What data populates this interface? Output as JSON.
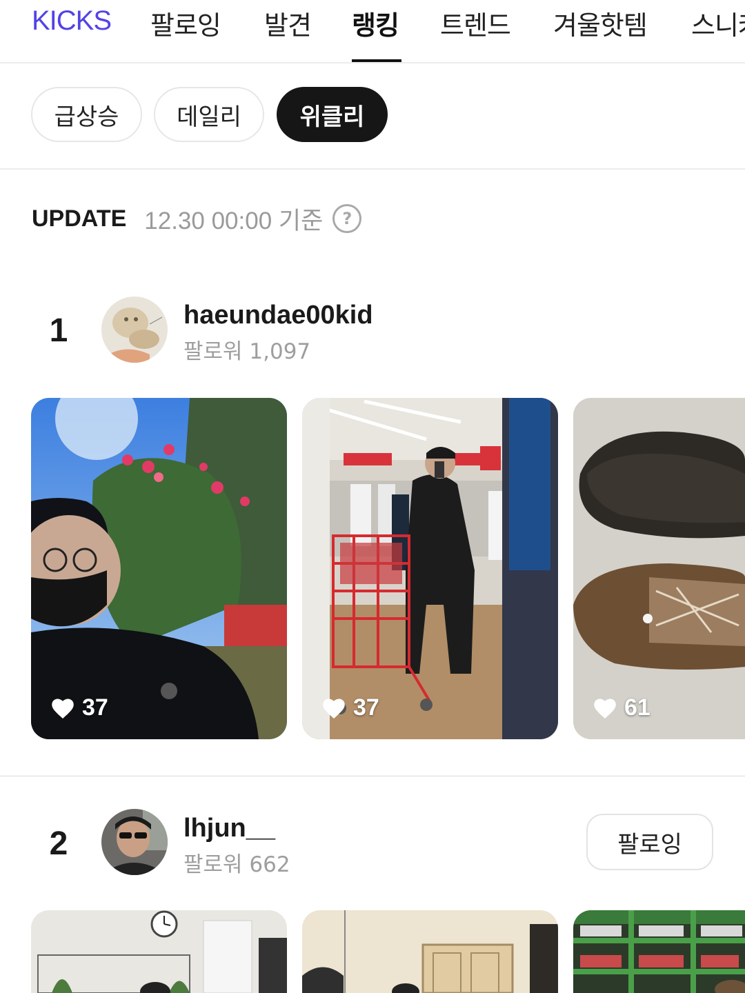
{
  "nav": {
    "tabs": [
      {
        "label": "KICKS"
      },
      {
        "label": "팔로잉"
      },
      {
        "label": "발견"
      },
      {
        "label": "랭킹"
      },
      {
        "label": "트렌드"
      },
      {
        "label": "겨울핫템"
      },
      {
        "label": "스니커"
      }
    ],
    "active_tab": "랭킹"
  },
  "filters": {
    "chips": [
      {
        "label": "급상승"
      },
      {
        "label": "데일리"
      },
      {
        "label": "위클리"
      }
    ],
    "active_chip": "위클리"
  },
  "update": {
    "label": "UPDATE",
    "time": "12.30 00:00 기준",
    "help_symbol": "?"
  },
  "rankings": [
    {
      "rank": "1",
      "username": "haeundae00kid",
      "followers": "팔로워 1,097",
      "posts": [
        {
          "likes": "37",
          "icon": "heart-icon"
        },
        {
          "likes": "37",
          "icon": "heart-icon"
        },
        {
          "likes": "61",
          "icon": "heart-icon"
        }
      ]
    },
    {
      "rank": "2",
      "username": "lhjun__",
      "followers": "팔로워 662",
      "follow_button": "팔로잉",
      "posts": [
        {
          "likes": ""
        },
        {
          "likes": ""
        },
        {
          "likes": ""
        }
      ]
    }
  ],
  "colors": {
    "brand": "#5243e6",
    "active_chip_bg": "#161616",
    "muted_text": "#9a9a9a"
  }
}
